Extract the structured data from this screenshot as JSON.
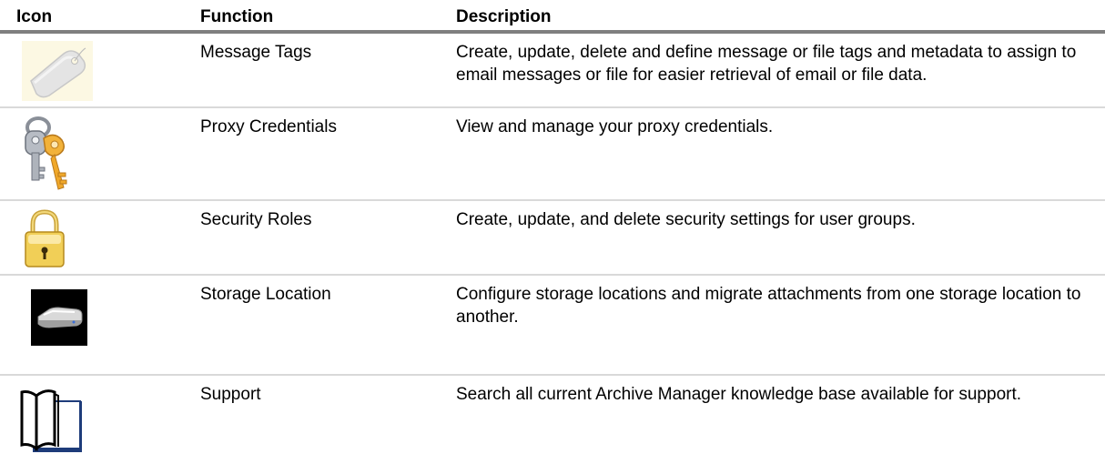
{
  "table": {
    "headers": {
      "icon": "Icon",
      "function": "Function",
      "description": "Description"
    },
    "rows": [
      {
        "icon": "message-tag-icon",
        "function": "Message Tags",
        "description": "Create, update, delete and define message or file tags and metadata to assign to email messages or file for easier retrieval of email or file data."
      },
      {
        "icon": "keys-icon",
        "function": "Proxy Credentials",
        "description": "View and manage your proxy credentials."
      },
      {
        "icon": "padlock-icon",
        "function": "Security Roles",
        "description": "Create, update, and delete security settings for user groups."
      },
      {
        "icon": "storage-drive-icon",
        "function": "Storage Location",
        "description": "Configure storage locations and migrate attachments from one storage location to another."
      },
      {
        "icon": "support-book-icon",
        "function": "Support",
        "description": "Search all current Archive Manager knowledge base available for support."
      }
    ]
  },
  "colors": {
    "header_rule": "#7f7f7f",
    "row_rule": "#d9d9d9"
  }
}
